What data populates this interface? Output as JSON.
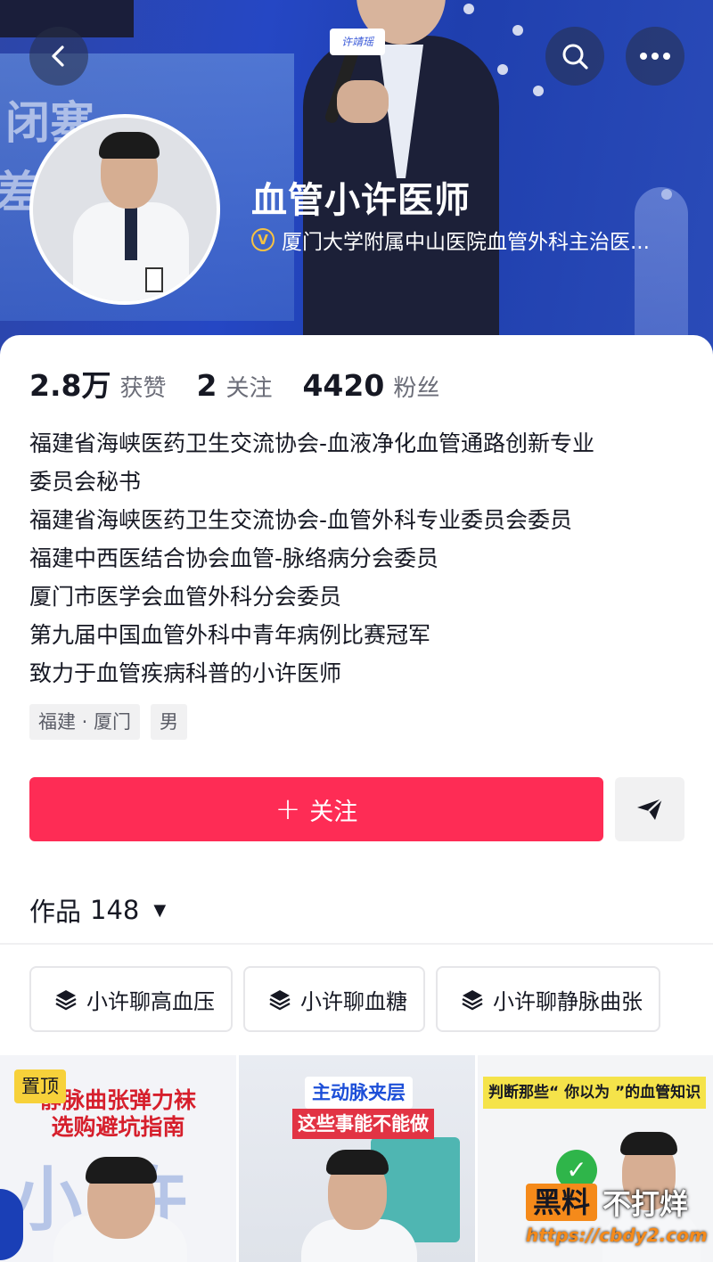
{
  "header": {
    "name": "血管小许医师",
    "verify_badge": "V",
    "verify_text": "厦门大学附属中山医院血管外科主治医...",
    "bg_texts": [
      "闭塞",
      "差"
    ],
    "mic_label": "许靖瑶"
  },
  "stats": [
    {
      "value": "2.8万",
      "label": "获赞"
    },
    {
      "value": "2",
      "label": "关注"
    },
    {
      "value": "4420",
      "label": "粉丝"
    }
  ],
  "bio": [
    "福建省海峡医药卫生交流协会-血液净化血管通路创新专业",
    "委员会秘书",
    "福建省海峡医药卫生交流协会-血管外科专业委员会委员",
    "福建中西医结合协会血管-脉络病分会委员",
    "厦门市医学会血管外科分会委员",
    "第九届中国血管外科中青年病例比赛冠军",
    "致力于血管疾病科普的小许医师"
  ],
  "tags": [
    "福建 · 厦门",
    "男"
  ],
  "actions": {
    "follow_label": "关注",
    "follow_plus": "+"
  },
  "works": {
    "label": "作品",
    "count": "148"
  },
  "collections": [
    "小许聊高血压",
    "小许聊血糖",
    "小许聊静脉曲张"
  ],
  "videos": [
    {
      "pin": "置顶",
      "title_line1": "静脉曲张弹力袜",
      "title_line2": "选购避坑指南",
      "bg_text": "小许"
    },
    {
      "tag1": "主动脉夹层",
      "tag2": "这些事能不能做"
    },
    {
      "tag": "判断那些“ 你以为 ”的血管知识",
      "check": "✓"
    }
  ],
  "watermark": {
    "box": "黑料",
    "text": "不打烊",
    "url": "https://cbdy2.com"
  },
  "colors": {
    "accent": "#fe2c55",
    "pin": "#f7d13a",
    "verify": "#f6c243"
  }
}
